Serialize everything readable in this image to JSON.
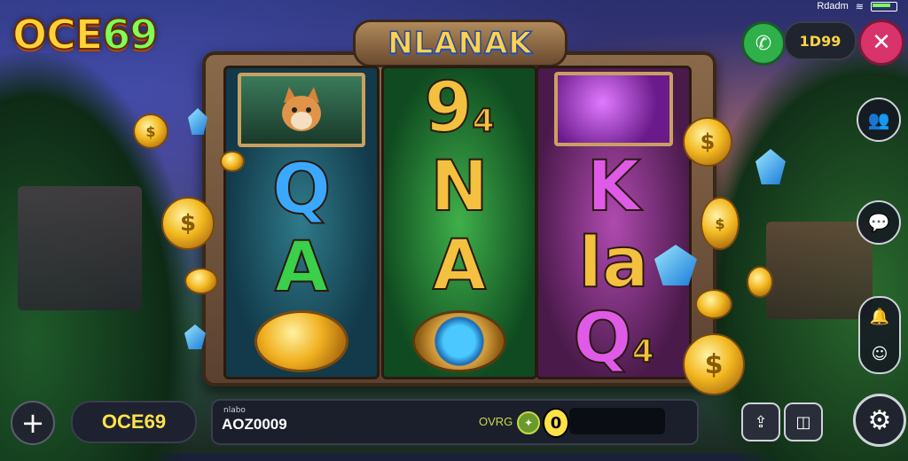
{
  "status_bar": {
    "label": "Rdadm",
    "wifi_icon": "wifi-icon",
    "battery_icon": "battery-icon"
  },
  "brand": {
    "logo_main": "OCE",
    "logo_num": "69"
  },
  "game": {
    "title": "NLANAK"
  },
  "reels": [
    {
      "symbols": [
        "cat-picture",
        "Q",
        "A",
        "gold-coin"
      ]
    },
    {
      "symbols": [
        "9",
        "N",
        "A",
        "blue-gem-ring"
      ]
    },
    {
      "symbols": [
        "purple-gem-picture",
        "K",
        "la",
        "Q"
      ]
    }
  ],
  "reel_labels": {
    "r2_top": "9",
    "r2_top_suffix": "4",
    "r1_mid": "Q",
    "r1_low": "A",
    "r2_mid": "N",
    "r2_low": "A",
    "r3_mid": "K",
    "r3_low": "la",
    "r3_bot": "Q",
    "r3_bot_suffix": "4"
  },
  "top_controls": {
    "credit": "1D99",
    "close_symbol": "✕",
    "phone_symbol": "✆"
  },
  "side_controls": {
    "profile_symbol": "👥",
    "chat_symbol": "💬",
    "bell_symbol": "🔔",
    "face_symbol": "☺"
  },
  "bottom": {
    "plus_symbol": "+",
    "player_name": "OCE69",
    "bar_small": "nlabo",
    "bar_value": "AOZ0009",
    "win_label": "OVRG",
    "coin_value": "0"
  },
  "colors": {
    "accent_gold": "#ffd23a",
    "close_pink": "#d8336a",
    "green": "#2fb04a"
  }
}
